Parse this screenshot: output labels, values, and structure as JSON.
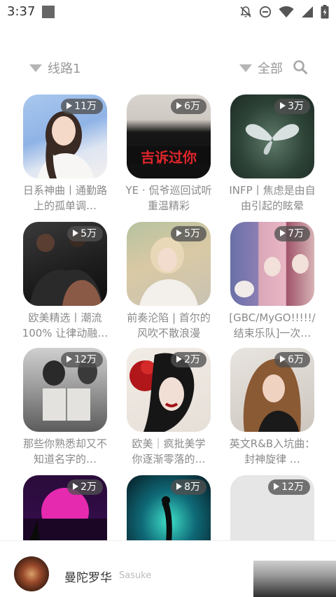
{
  "status_bar": {
    "time": "3:37",
    "icons": [
      "notifications-off-icon",
      "do-not-disturb-icon",
      "wifi-icon",
      "signal-icon",
      "battery-charging-icon"
    ]
  },
  "filters": {
    "route_label": "线路1",
    "category_label": "全部",
    "search_icon": "search-icon"
  },
  "playlists": [
    {
      "plays": "11万",
      "title": "日系神曲丨通勤路上的孤单调…"
    },
    {
      "plays": "6万",
      "title": "YE · 侃爷巡回试听 重温精彩"
    },
    {
      "plays": "3万",
      "title": "INFP丨焦虑是由自由引起的眩晕"
    },
    {
      "plays": "5万",
      "title": "欧美精选丨潮流100% 让律动融…"
    },
    {
      "plays": "5万",
      "title": "前奏沦陷 | 首尔的风吹不散浪漫"
    },
    {
      "plays": "7万",
      "title": "[GBC/MyGO!!!!!/结束乐队]一次…"
    },
    {
      "plays": "12万",
      "title": "那些你熟悉却又不知道名字的…"
    },
    {
      "plays": "2万",
      "title": "欧美｜疯批美学 你逐渐零落的…"
    },
    {
      "plays": "6万",
      "title": "英文R&B入坑曲：封神旋律 …"
    },
    {
      "plays": "2万",
      "title": ""
    },
    {
      "plays": "8万",
      "title": ""
    },
    {
      "plays": "12万",
      "title": ""
    }
  ],
  "player": {
    "title": "曼陀罗华",
    "artist": "Sasuke"
  }
}
